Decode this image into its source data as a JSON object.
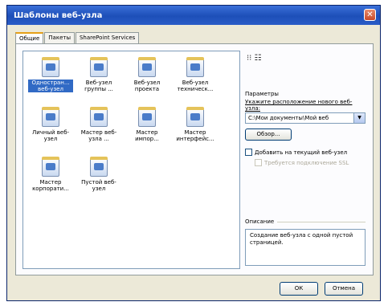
{
  "window": {
    "title": "Шаблоны веб-узла",
    "close_icon": "close-icon"
  },
  "tabs": [
    {
      "label": "Общие",
      "active": true
    },
    {
      "label": "Пакеты",
      "active": false
    },
    {
      "label": "SharePoint Services",
      "active": false
    }
  ],
  "templates": [
    {
      "label": "Одностран... веб-узел",
      "selected": true
    },
    {
      "label": "Веб-узел группы ...",
      "selected": false
    },
    {
      "label": "Веб-узел проекта",
      "selected": false
    },
    {
      "label": "Веб-узел техническ...",
      "selected": false
    },
    {
      "label": "Личный веб-узел",
      "selected": false
    },
    {
      "label": "Мастер веб-узла ...",
      "selected": false
    },
    {
      "label": "Мастер импор...",
      "selected": false
    },
    {
      "label": "Мастер интерфейс...",
      "selected": false
    },
    {
      "label": "Мастер корпорати...",
      "selected": false
    },
    {
      "label": "Пустой веб-узел",
      "selected": false
    }
  ],
  "options": {
    "view_icons": "⁝⁝ ☷",
    "heading": "Параметры",
    "location_label": "Укажите расположение нового веб-узла:",
    "location_value": "C:\\Мои документы\\Мой веб",
    "browse_label": "Обзор...",
    "add_to_current_label": "Добавить на текущий веб-узел",
    "ssl_label": "Требуется подключение SSL"
  },
  "description": {
    "heading": "Описание",
    "text": "Создание веб-узла с одной пустой страницей."
  },
  "footer": {
    "ok_label": "ОК",
    "cancel_label": "Отмена"
  }
}
